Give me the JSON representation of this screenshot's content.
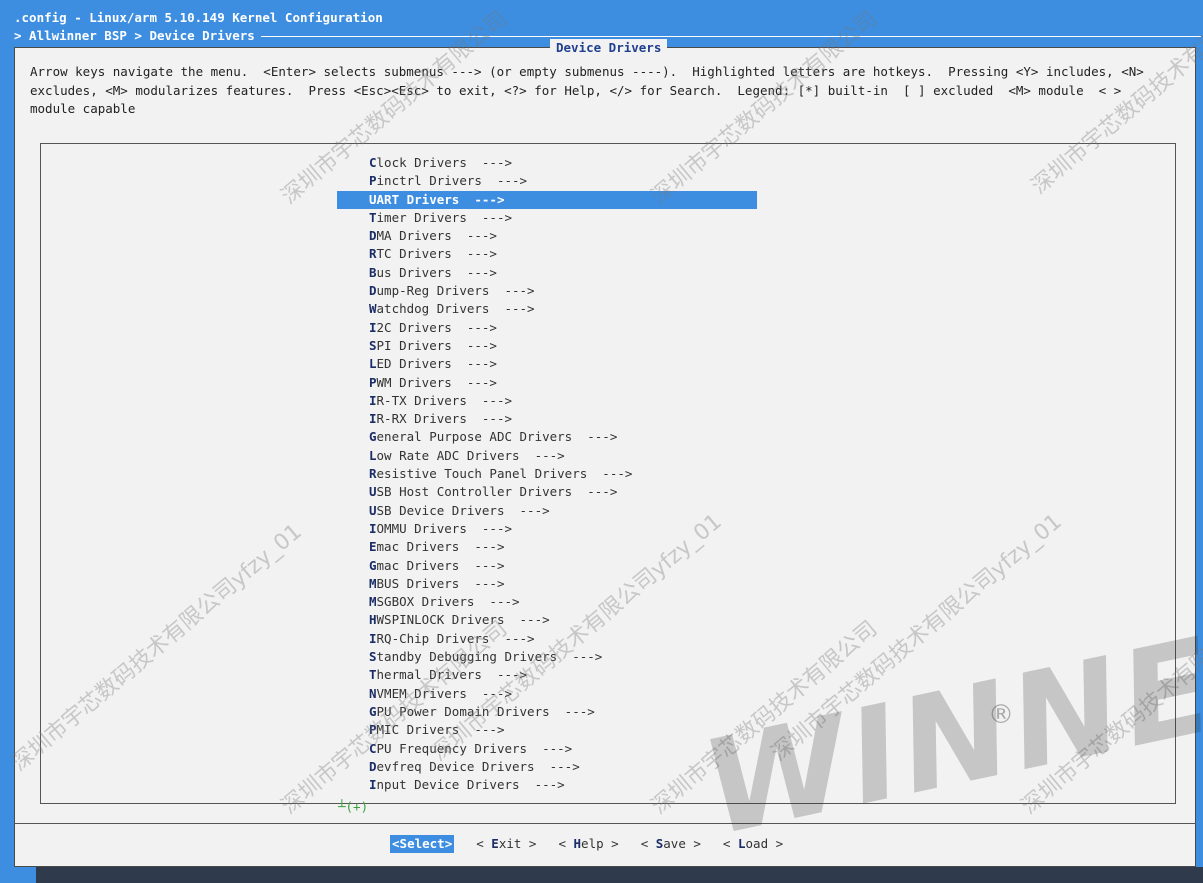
{
  "header": {
    "line1": ".config - Linux/arm 5.10.149 Kernel Configuration",
    "line2": "> Allwinner BSP > Device Drivers"
  },
  "dialog": {
    "title": "Device Drivers",
    "help_lines": [
      "Arrow keys navigate the menu.  <Enter> selects submenus ---> (or empty submenus ----).  Highlighted letters are hotkeys.  Pressing <Y> includes, <N>",
      "excludes, <M> modularizes features.  Press <Esc><Esc> to exit, <?> for Help, </> for Search.  Legend: [*] built-in  [ ] excluded  <M> module  < >",
      "module capable"
    ]
  },
  "menu": {
    "selected_index": 2,
    "items": [
      {
        "hk": "C",
        "rest": "lock Drivers  --->"
      },
      {
        "hk": "P",
        "rest": "inctrl Drivers  --->"
      },
      {
        "hk": "U",
        "rest": "ART Drivers  --->"
      },
      {
        "hk": "T",
        "rest": "imer Drivers  --->"
      },
      {
        "hk": "D",
        "rest": "MA Drivers  --->"
      },
      {
        "hk": "R",
        "rest": "TC Drivers  --->"
      },
      {
        "hk": "B",
        "rest": "us Drivers  --->"
      },
      {
        "hk": "D",
        "rest": "ump-Reg Drivers  --->"
      },
      {
        "hk": "W",
        "rest": "atchdog Drivers  --->"
      },
      {
        "hk": "I",
        "rest": "2C Drivers  --->"
      },
      {
        "hk": "S",
        "rest": "PI Drivers  --->"
      },
      {
        "hk": "L",
        "rest": "ED Drivers  --->"
      },
      {
        "hk": "P",
        "rest": "WM Drivers  --->"
      },
      {
        "hk": "I",
        "rest": "R-TX Drivers  --->"
      },
      {
        "hk": "I",
        "rest": "R-RX Drivers  --->"
      },
      {
        "hk": "G",
        "rest": "eneral Purpose ADC Drivers  --->"
      },
      {
        "hk": "L",
        "rest": "ow Rate ADC Drivers  --->"
      },
      {
        "hk": "R",
        "rest": "esistive Touch Panel Drivers  --->"
      },
      {
        "hk": "U",
        "rest": "SB Host Controller Drivers  --->"
      },
      {
        "hk": "U",
        "rest": "SB Device Drivers  --->"
      },
      {
        "hk": "I",
        "rest": "OMMU Drivers  --->"
      },
      {
        "hk": "E",
        "rest": "mac Drivers  --->"
      },
      {
        "hk": "G",
        "rest": "mac Drivers  --->"
      },
      {
        "hk": "M",
        "rest": "BUS Drivers  --->"
      },
      {
        "hk": "M",
        "rest": "SGBOX Drivers  --->"
      },
      {
        "hk": "H",
        "rest": "WSPINLOCK Drivers  --->"
      },
      {
        "hk": "I",
        "rest": "RQ-Chip Drivers  --->"
      },
      {
        "hk": "S",
        "rest": "tandby Debugging Drivers  --->"
      },
      {
        "hk": "T",
        "rest": "hermal Drivers  --->"
      },
      {
        "hk": "N",
        "rest": "VMEM Drivers  --->"
      },
      {
        "hk": "G",
        "rest": "PU Power Domain Drivers  --->"
      },
      {
        "hk": "P",
        "rest": "MIC Drivers  --->"
      },
      {
        "hk": "C",
        "rest": "PU Frequency Drivers  --->"
      },
      {
        "hk": "D",
        "rest": "evfreq Device Drivers  --->"
      },
      {
        "hk": "I",
        "rest": "nput Device Drivers  --->"
      }
    ],
    "more_indicator": "┴(+)"
  },
  "buttons": [
    {
      "pre": "<",
      "hk": "S",
      "rest": "elect>",
      "selected": true
    },
    {
      "pre": "< ",
      "hk": "E",
      "rest": "xit >",
      "selected": false
    },
    {
      "pre": "< ",
      "hk": "H",
      "rest": "elp >",
      "selected": false
    },
    {
      "pre": "< ",
      "hk": "S",
      "rest": "ave >",
      "selected": false
    },
    {
      "pre": "< ",
      "hk": "L",
      "rest": "oad >",
      "selected": false
    }
  ],
  "watermarks": {
    "text_a": "深圳市宇芯数码技术有限公司yfzy_01",
    "text_b": "深圳市宇芯数码技术有限公司",
    "logo": "WINNER",
    "registered": "®"
  },
  "colors": {
    "terminal_blue": "#3d8ee0",
    "dialog_bg": "#f2f2f2",
    "hotkey": "#1b2d66"
  }
}
